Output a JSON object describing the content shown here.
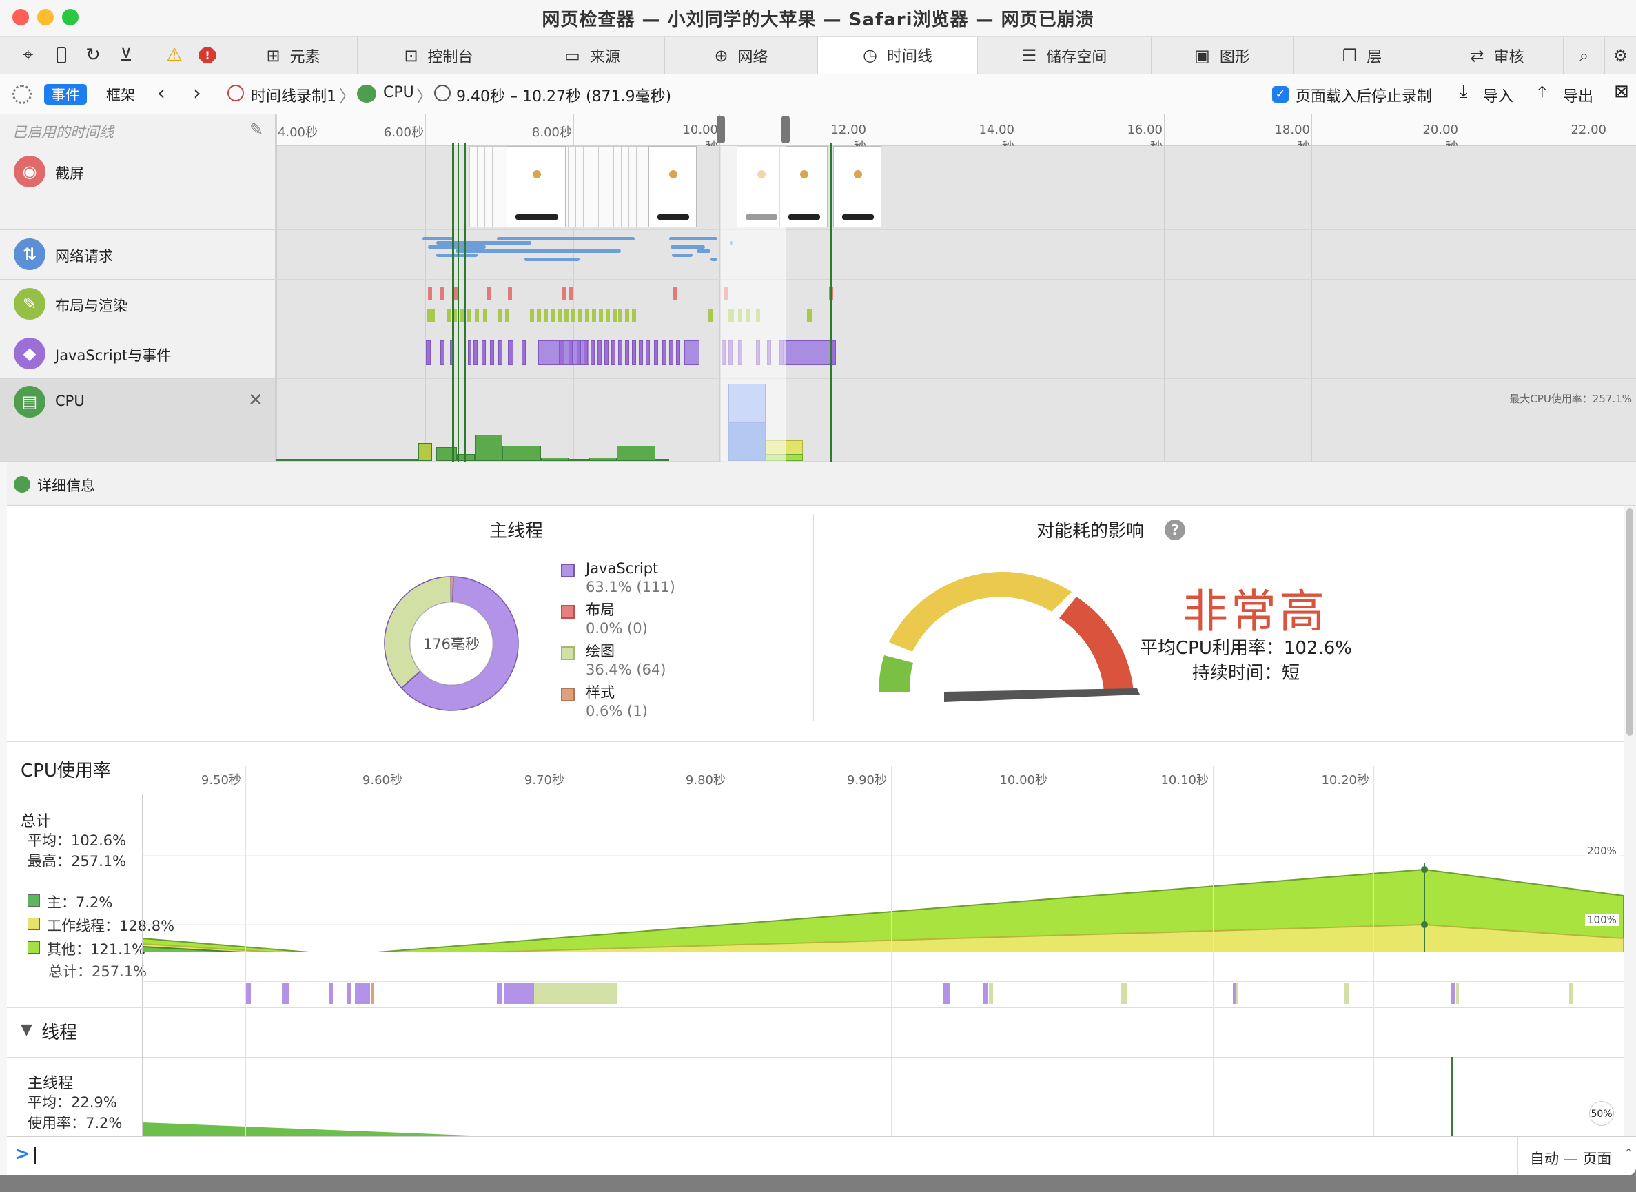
{
  "window": {
    "title": "网页检查器 — 小刘同学的大苹果 — Safari浏览器 — 网页已崩溃"
  },
  "tabs": [
    {
      "label": "元素",
      "icon": "elements-icon"
    },
    {
      "label": "控制台",
      "icon": "console-icon"
    },
    {
      "label": "来源",
      "icon": "sources-icon"
    },
    {
      "label": "网络",
      "icon": "network-icon"
    },
    {
      "label": "时间线",
      "icon": "timeline-icon",
      "active": true
    },
    {
      "label": "储存空间",
      "icon": "storage-icon"
    },
    {
      "label": "图形",
      "icon": "graphics-icon"
    },
    {
      "label": "层",
      "icon": "layers-icon"
    },
    {
      "label": "审核",
      "icon": "audit-icon"
    }
  ],
  "subbar": {
    "events_label": "事件",
    "frames_label": "框架",
    "breadcrumb_recording": "时间线录制1",
    "breadcrumb_cpu": "CPU",
    "range": "9.40秒 – 10.27秒 (871.9毫秒)",
    "stop_checkbox_label": "页面载入后停止录制",
    "stop_checked": true,
    "import_label": "导入",
    "export_label": "导出"
  },
  "ruler": {
    "filter_placeholder": "已启用的时间线",
    "ticks": [
      "4.00秒",
      "6.00秒",
      "8.00秒",
      "10.00秒",
      "12.00秒",
      "14.00秒",
      "16.00秒",
      "18.00秒",
      "20.00秒",
      "22.00"
    ]
  },
  "tracks": [
    {
      "label": "截屏",
      "icon": "camera-icon",
      "color": "#e06a6a"
    },
    {
      "label": "网络请求",
      "icon": "network-request-icon",
      "color": "#5b8fd6"
    },
    {
      "label": "布局与渲染",
      "icon": "brush-icon",
      "color": "#95bf47"
    },
    {
      "label": "JavaScript与事件",
      "icon": "script-icon",
      "color": "#9c6fd6"
    },
    {
      "label": "CPU",
      "icon": "cpu-icon",
      "color": "#4f9e4f"
    }
  ],
  "cpu_track": {
    "max_label": "最大CPU使用率：257.1%"
  },
  "details": {
    "header_label": "详细信息",
    "main_thread": {
      "title": "主线程",
      "center_label": "176毫秒",
      "legend": [
        {
          "name": "JavaScript",
          "stat": "63.1% (111)",
          "color": "#b393e8"
        },
        {
          "name": "布局",
          "stat": "0.0% (0)",
          "color": "#e58080"
        },
        {
          "name": "绘图",
          "stat": "36.4% (64)",
          "color": "#d2e0a6"
        },
        {
          "name": "样式",
          "stat": "0.6% (1)",
          "color": "#e0a080"
        }
      ]
    },
    "energy": {
      "title": "对能耗的影响",
      "help": "?",
      "level": "非常高",
      "avg_cpu": "平均CPU利用率：102.6%",
      "duration": "持续时间：短"
    }
  },
  "cpu_usage": {
    "title": "CPU使用率",
    "ticks": [
      "9.50秒",
      "9.60秒",
      "9.70秒",
      "9.80秒",
      "9.90秒",
      "10.00秒",
      "10.10秒",
      "10.20秒"
    ],
    "total_label": "总计",
    "avg": "平均：102.6%",
    "max": "最高：257.1%",
    "legend": [
      {
        "label": "主：7.2%",
        "color": "#5cb85c"
      },
      {
        "label": "工作线程：128.8%",
        "color": "#e6e26a"
      },
      {
        "label": "其他：121.1%",
        "color": "#a3e046"
      }
    ],
    "sum": "总计：257.1%",
    "marks": [
      "200%",
      "100%"
    ]
  },
  "threads": {
    "title": "线程",
    "main_label": "主线程",
    "main_avg": "平均：22.9%",
    "main_usage": "使用率：7.2%",
    "mark": "50%"
  },
  "console": {
    "prompt": ">",
    "scope": "自动 — 页面"
  }
}
